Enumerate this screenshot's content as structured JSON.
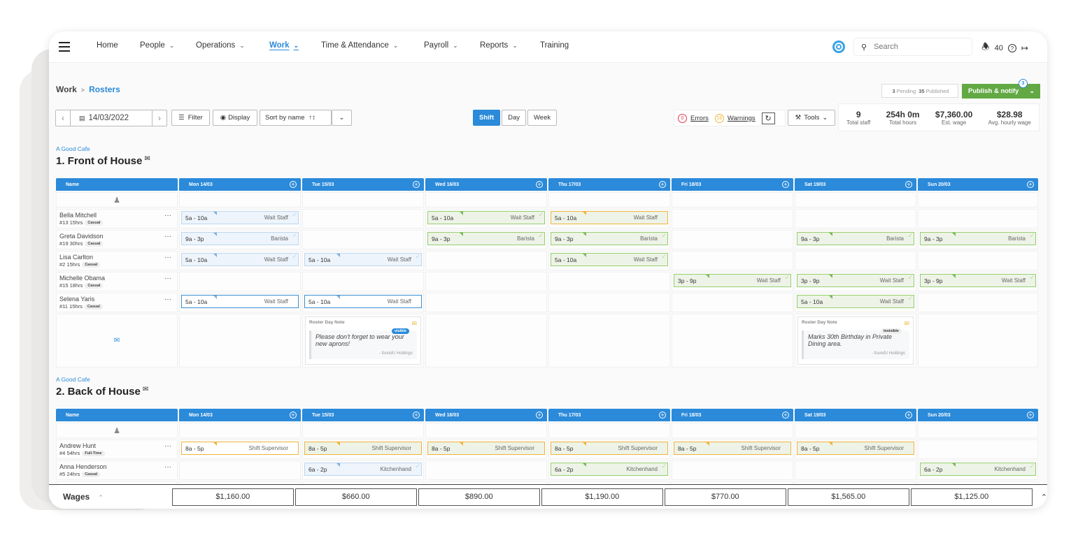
{
  "nav": {
    "items": [
      {
        "label": "Home",
        "dropdown": false
      },
      {
        "label": "People",
        "dropdown": true
      },
      {
        "label": "Operations",
        "dropdown": true
      },
      {
        "label": "Work",
        "dropdown": true,
        "active": true
      },
      {
        "label": "Time & Attendance",
        "dropdown": true
      },
      {
        "label": "Payroll",
        "dropdown": true
      },
      {
        "label": "Reports",
        "dropdown": true
      },
      {
        "label": "Training",
        "dropdown": false
      }
    ],
    "search_placeholder": "Search",
    "notification_count": "40",
    "help_glyph": "?",
    "chevron": "⌄"
  },
  "breadcrumb": {
    "parent": "Work",
    "separator": ">",
    "current": "Rosters"
  },
  "toolbar": {
    "date": "14/03/2022",
    "filter": "Filter",
    "display": "Display",
    "sort": "Sort by name",
    "views": [
      "Shift",
      "Day",
      "Week"
    ],
    "active_view": "Shift",
    "errors_count": "0",
    "errors_label": "Errors",
    "warnings_count": "16",
    "warnings_label": "Warnings",
    "tools": "Tools",
    "pending_count": "3",
    "pending_label": "Pending",
    "published_count": "35",
    "published_label": "Published",
    "publish_label": "Publish & notify",
    "publish_badge": "3"
  },
  "stats": [
    {
      "value": "9",
      "label": "Total staff"
    },
    {
      "value": "254h 0m",
      "label": "Total hours"
    },
    {
      "value": "$7,360.00",
      "label": "Est. wage"
    },
    {
      "value": "$28.98",
      "label": "Avg. hourly wage"
    }
  ],
  "days": [
    "Mon 14/03",
    "Tue 15/03",
    "Wed 16/03",
    "Thu 17/03",
    "Fri 18/03",
    "Sat 19/03",
    "Sun 20/03"
  ],
  "name_header": "Name",
  "sections": [
    {
      "org": "A Good Cafe",
      "title": "1. Front of House",
      "staff": [
        {
          "name": "Bella Mitchell",
          "id": "#13",
          "hours": "15hrs",
          "type": "Casual",
          "shifts": [
            {
              "day": 0,
              "time": "5a - 10a",
              "role": "Wait Staff",
              "style": "blue"
            },
            {
              "day": 2,
              "time": "5a - 10a",
              "role": "Wait Staff",
              "style": "green"
            },
            {
              "day": 3,
              "time": "5a - 10a",
              "role": "Wait Staff",
              "style": "orange"
            }
          ]
        },
        {
          "name": "Greta Davidson",
          "id": "#19",
          "hours": "30hrs",
          "type": "Casual",
          "shifts": [
            {
              "day": 0,
              "time": "9a - 3p",
              "role": "Barista",
              "style": "blue"
            },
            {
              "day": 2,
              "time": "9a - 3p",
              "role": "Barista",
              "style": "green"
            },
            {
              "day": 3,
              "time": "9a - 3p",
              "role": "Barista",
              "style": "green"
            },
            {
              "day": 5,
              "time": "9a - 3p",
              "role": "Barista",
              "style": "green"
            },
            {
              "day": 6,
              "time": "9a - 3p",
              "role": "Barista",
              "style": "green"
            }
          ]
        },
        {
          "name": "Lisa Carlton",
          "id": "#2",
          "hours": "15hrs",
          "type": "Casual",
          "shifts": [
            {
              "day": 0,
              "time": "5a - 10a",
              "role": "Wait Staff",
              "style": "blue"
            },
            {
              "day": 1,
              "time": "5a - 10a",
              "role": "Wait Staff",
              "style": "blue"
            },
            {
              "day": 3,
              "time": "5a - 10a",
              "role": "Wait Staff",
              "style": "green"
            }
          ]
        },
        {
          "name": "Michelle Obama",
          "id": "#15",
          "hours": "18hrs",
          "type": "Casual",
          "shifts": [
            {
              "day": 4,
              "time": "3p - 9p",
              "role": "Wait Staff",
              "style": "green"
            },
            {
              "day": 5,
              "time": "3p - 9p",
              "role": "Wait Staff",
              "style": "green"
            },
            {
              "day": 6,
              "time": "3p - 9p",
              "role": "Wait Staff",
              "style": "green"
            }
          ]
        },
        {
          "name": "Selena Yaris",
          "id": "#11",
          "hours": "15hrs",
          "type": "Casual",
          "shifts": [
            {
              "day": 0,
              "time": "5a - 10a",
              "role": "Wait Staff",
              "style": "blueo"
            },
            {
              "day": 1,
              "time": "5a - 10a",
              "role": "Wait Staff",
              "style": "blueo"
            },
            {
              "day": 5,
              "time": "5a - 10a",
              "role": "Wait Staff",
              "style": "green"
            }
          ]
        }
      ],
      "notes": [
        {
          "day": 1,
          "heading": "Roster Day Note",
          "visibility": "visible",
          "text": "Please don't forget to wear your new aprons!",
          "author": "- foundU Holdings"
        },
        {
          "day": 5,
          "heading": "Roster Day Note",
          "visibility": "invisible",
          "text": "Marks 30th Birthday in Private Dining area.",
          "author": "- foundU Holdings"
        }
      ]
    },
    {
      "org": "A Good Cafe",
      "title": "2. Back of House",
      "staff": [
        {
          "name": "Andrew Hunt",
          "id": "#4",
          "hours": "54hrs",
          "type": "Full-Time",
          "shifts": [
            {
              "day": 0,
              "time": "8a - 5p",
              "role": "Shift Supervisor",
              "style": "orangew"
            },
            {
              "day": 1,
              "time": "8a - 5p",
              "role": "Shift Supervisor",
              "style": "orange"
            },
            {
              "day": 2,
              "time": "8a - 5p",
              "role": "Shift Supervisor",
              "style": "orange"
            },
            {
              "day": 3,
              "time": "8a - 5p",
              "role": "Shift Supervisor",
              "style": "orange"
            },
            {
              "day": 4,
              "time": "8a - 5p",
              "role": "Shift Supervisor",
              "style": "orange"
            },
            {
              "day": 5,
              "time": "8a - 5p",
              "role": "Shift Supervisor",
              "style": "orange"
            }
          ]
        },
        {
          "name": "Anna Henderson",
          "id": "#5",
          "hours": "24hrs",
          "type": "Casual",
          "shifts": [
            {
              "day": 1,
              "time": "6a - 2p",
              "role": "Kitchenhand",
              "style": "blue"
            },
            {
              "day": 3,
              "time": "6a - 2p",
              "role": "Kitchenhand",
              "style": "green"
            },
            {
              "day": 6,
              "time": "6a - 2p",
              "role": "Kitchenhand",
              "style": "green"
            }
          ]
        }
      ]
    }
  ],
  "wages": {
    "label": "Wages",
    "values": [
      "$1,160.00",
      "$660.00",
      "$890.00",
      "$1,190.00",
      "$770.00",
      "$1,565.00",
      "$1,125.00"
    ]
  },
  "colors": {
    "accent": "#2b8ad9",
    "publish": "#62a944",
    "warning": "#f0b43a",
    "error": "#e0384d"
  }
}
